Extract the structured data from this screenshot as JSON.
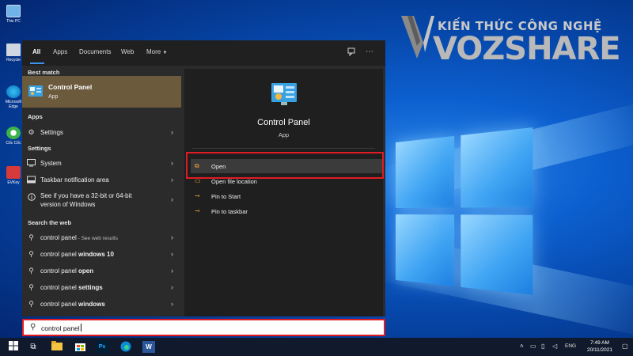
{
  "desktop": {
    "icons": [
      {
        "label": "This PC"
      },
      {
        "label": "Recycle"
      },
      {
        "label": "Microsoft Edge"
      },
      {
        "label": "Cốc Cốc"
      },
      {
        "label": "EVKey"
      }
    ],
    "watermark": {
      "top": "KIẾN THỨC CÔNG NGHỆ",
      "main": "VOZSHARE"
    }
  },
  "search_panel": {
    "tabs": [
      {
        "label": "All",
        "active": true
      },
      {
        "label": "Apps"
      },
      {
        "label": "Documents"
      },
      {
        "label": "Web"
      },
      {
        "label": "More",
        "icon": "caret-down-icon"
      }
    ],
    "toolbar_icons": [
      "feedback-icon",
      "more-options-icon"
    ],
    "sections": {
      "best_match": "Best match",
      "apps": "Apps",
      "settings": "Settings",
      "search_web": "Search the web"
    },
    "best_match": {
      "title": "Control Panel",
      "subtitle": "App",
      "icon": "control-panel-icon"
    },
    "apps": [
      {
        "label": "Settings",
        "icon": "gear-icon"
      }
    ],
    "settings": [
      {
        "label": "System",
        "icon": "monitor-icon"
      },
      {
        "label": "Taskbar notification area",
        "icon": "taskbar-icon"
      },
      {
        "label_line1": "See if you have a 32-bit or 64-bit",
        "label_line2": "version of Windows",
        "icon": "info-icon"
      }
    ],
    "web": [
      {
        "prefix": "control panel",
        "suffix": " - See web results"
      },
      {
        "prefix": "control panel ",
        "bold": "windows 10"
      },
      {
        "prefix": "control panel ",
        "bold": "open"
      },
      {
        "prefix": "control panel ",
        "bold": "settings"
      },
      {
        "prefix": "control panel ",
        "bold": "windows"
      }
    ],
    "detail": {
      "title": "Control Panel",
      "subtitle": "App",
      "actions": [
        {
          "label": "Open",
          "icon": "open-icon"
        },
        {
          "label": "Open file location",
          "icon": "folder-icon"
        },
        {
          "label": "Pin to Start",
          "icon": "pin-icon"
        },
        {
          "label": "Pin to taskbar",
          "icon": "pin-icon"
        }
      ]
    }
  },
  "search_box": {
    "value": "control panel",
    "icon": "search-icon"
  },
  "taskbar": {
    "apps": [
      "windows-logo-icon",
      "task-view-icon",
      "file-explorer-icon",
      "store-icon",
      "photoshop-icon",
      "edge-icon",
      "word-icon"
    ],
    "photoshop_label": "Ps",
    "word_label": "W",
    "tray": {
      "lang": "ENG",
      "time": "7:49 AM",
      "date": "20/11/2021"
    }
  },
  "colors": {
    "accent": "#3c93f0",
    "best_match_bg": "#6c5a3d",
    "highlight_border": "#e11b22",
    "panel_bg": "#2b2b2b",
    "detail_bg": "#1f1f1f",
    "taskbar_bg": "#101a2c"
  }
}
